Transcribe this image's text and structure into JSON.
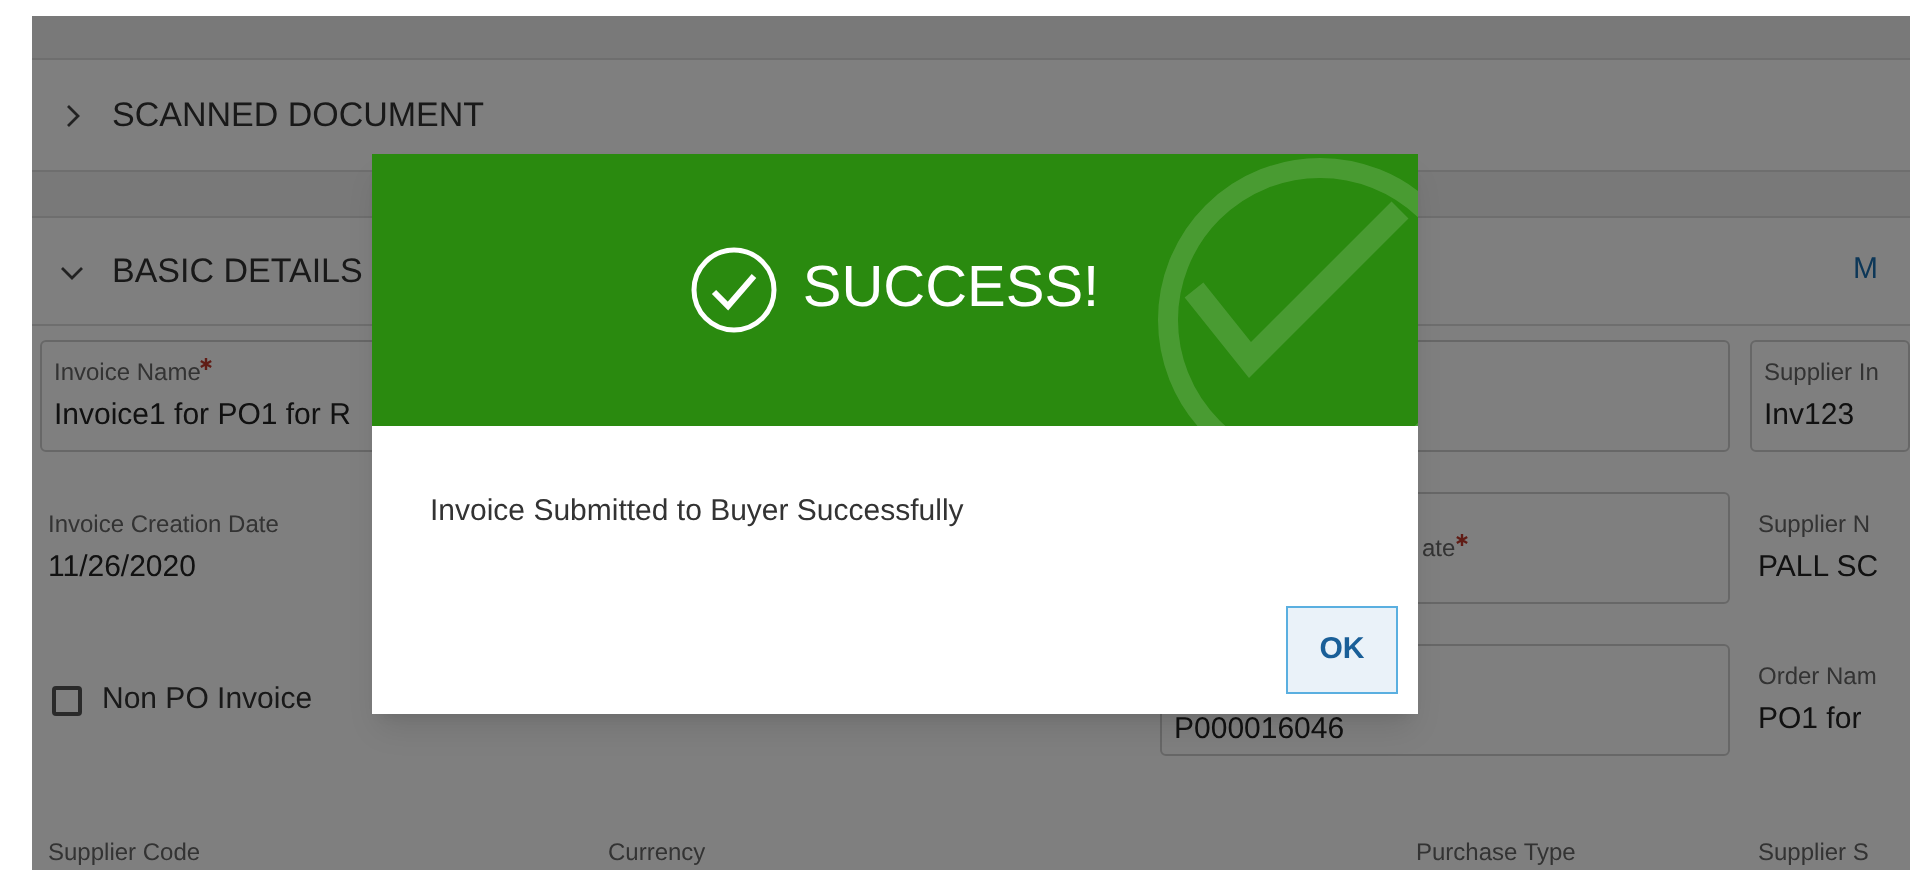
{
  "sections": [
    {
      "title": "SCANNED DOCUMENT",
      "expanded": false
    },
    {
      "title": "BASIC DETAILS",
      "expanded": true,
      "link": "M"
    }
  ],
  "rows": [
    [
      {
        "kind": "outlined",
        "label": "Invoice Name",
        "required": true,
        "value": "Invoice1 for PO1 for R"
      },
      {
        "kind": "hidden"
      },
      {
        "kind": "outlined"
      },
      {
        "kind": "outlined",
        "label": "Supplier In",
        "value": "Inv123"
      }
    ],
    [
      {
        "kind": "plain",
        "label": "Invoice Creation Date",
        "value": "11/26/2020"
      },
      {
        "kind": "hidden"
      },
      {
        "kind": "outlined",
        "label": "ate",
        "required": true
      },
      {
        "kind": "plain",
        "label": "Supplier N",
        "value": "PALL SC"
      }
    ],
    [
      {
        "kind": "checkbox",
        "label": "Non PO Invoice",
        "checked": false
      },
      {
        "kind": "hidden"
      },
      {
        "kind": "outlined",
        "value": "P000016046"
      },
      {
        "kind": "plain",
        "label": "Order Nam",
        "value": "PO1 for"
      }
    ],
    [
      {
        "kind": "plain",
        "label": "Supplier Code"
      },
      {
        "kind": "plain",
        "label": "Currency"
      },
      {
        "kind": "plain",
        "label": "Purchase Type"
      },
      {
        "kind": "plain",
        "label": "Supplier S"
      }
    ]
  ],
  "dialog": {
    "title": "SUCCESS!",
    "message": "Invoice Submitted to Buyer Successfully",
    "button": "OK"
  }
}
